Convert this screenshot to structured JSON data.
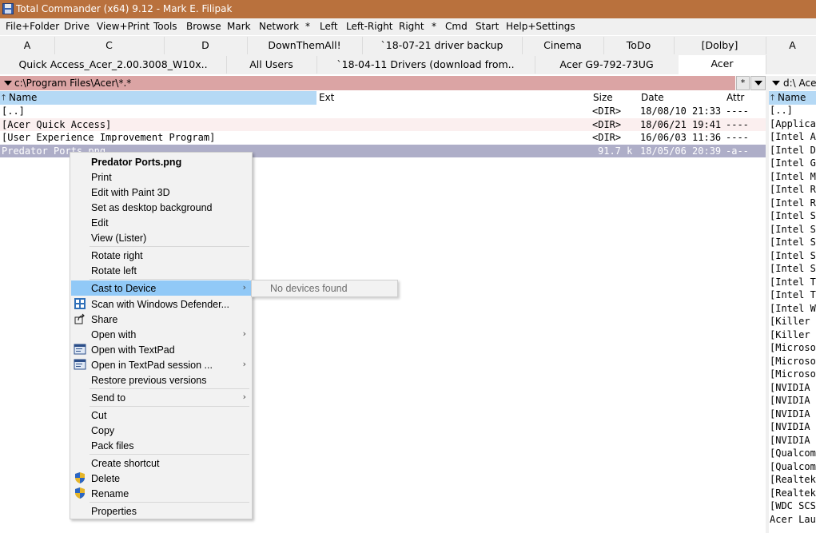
{
  "window": {
    "title": "Total Commander (x64) 9.12 - Mark E. Filipak"
  },
  "menu": [
    "File+Folder",
    "Drive",
    "View+Print",
    "Tools",
    "Browse",
    "Mark",
    "Network",
    "*",
    "Left",
    "Left-Right",
    "Right",
    "*",
    "Cmd",
    "Start",
    "Help+Settings"
  ],
  "tabs_row1": [
    "A",
    "C",
    "D",
    "DownThemAll!",
    "`18-07-21 driver backup",
    "Cinema",
    "ToDo",
    "[Dolby]"
  ],
  "tabs_row2": [
    "Quick Access_Acer_2.00.3008_W10x..",
    "All Users",
    "`18-04-11 Drivers (download from..",
    "Acer G9-792-73UG",
    "Acer"
  ],
  "right_tabs": {
    "row1": "A"
  },
  "left_panel": {
    "path": "c:\\Program Files\\Acer\\*.*",
    "star": "*",
    "headers": {
      "name": "Name",
      "ext": "Ext",
      "size": "Size",
      "date": "Date",
      "attr": "Attr"
    },
    "rows": [
      {
        "name": "[..]",
        "size": "<DIR>",
        "date": "18/08/10 21:33",
        "attr": "----"
      },
      {
        "name": "[Acer Quick Access]",
        "size": "<DIR>",
        "date": "18/06/21 19:41",
        "attr": "----"
      },
      {
        "name": "[User Experience Improvement Program]",
        "size": "<DIR>",
        "date": "16/06/03 11:36",
        "attr": "----"
      },
      {
        "name": "Predator Ports.png",
        "size": "91.7 k",
        "date": "18/05/06 20:39",
        "attr": "-a--"
      }
    ]
  },
  "right_panel": {
    "path": "d:\\ Ace",
    "header_name": "Name",
    "rows": [
      "[..]",
      "[Applica",
      "[Intel A",
      "[Intel D",
      "[Intel G",
      "[Intel M",
      "[Intel R",
      "[Intel R",
      "[Intel S",
      "[Intel S",
      "[Intel S",
      "[Intel S",
      "[Intel S",
      "[Intel T",
      "[Intel T",
      "[Intel W",
      "[Killer",
      "[Killer",
      "[Microso",
      "[Microso",
      "[Microso",
      "[NVIDIA",
      "[NVIDIA",
      "[NVIDIA",
      "[NVIDIA",
      "[NVIDIA",
      "[Qualcom",
      "[Qualcom",
      "[Realtek",
      "[Realtek",
      "[WDC SCS",
      "Acer Lau"
    ]
  },
  "context_menu": {
    "items": [
      {
        "label": "Predator Ports.png",
        "bold": true
      },
      {
        "label": "Print"
      },
      {
        "label": "Edit with Paint 3D"
      },
      {
        "label": "Set as desktop background"
      },
      {
        "label": "Edit"
      },
      {
        "label": "View (Lister)"
      },
      {
        "label": "Rotate right"
      },
      {
        "label": "Rotate left"
      },
      {
        "label": "Cast to Device",
        "submenu": true,
        "highlighted": true
      },
      {
        "label": "Scan with Windows Defender...",
        "icon": "defender-icon"
      },
      {
        "label": "Share",
        "icon": "share-icon"
      },
      {
        "label": "Open with",
        "submenu": true
      },
      {
        "label": "Open with TextPad",
        "icon": "textpad-icon"
      },
      {
        "label": "Open in TextPad session ...",
        "icon": "textpad-icon",
        "submenu": true
      },
      {
        "label": "Restore previous versions"
      },
      {
        "label": "Send to",
        "submenu": true
      },
      {
        "label": "Cut"
      },
      {
        "label": "Copy"
      },
      {
        "label": "Pack files"
      },
      {
        "label": "Create shortcut"
      },
      {
        "label": "Delete",
        "icon": "uac-shield-icon"
      },
      {
        "label": "Rename",
        "icon": "uac-shield-icon"
      },
      {
        "label": "Properties"
      }
    ],
    "submenu_text": "No devices found",
    "arrow_glyph": "›"
  },
  "colors": {
    "title_bar": "#b9713d",
    "path_bar": "#dba4a4",
    "selected_row": "#aeaec8",
    "menu_highlight": "#91c9f7",
    "header_highlight": "#b5d9f5"
  }
}
